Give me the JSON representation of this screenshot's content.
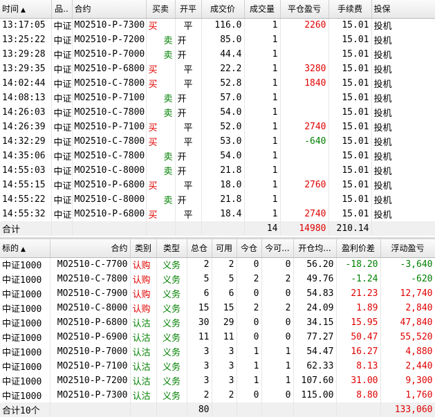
{
  "trades": {
    "headers": {
      "time": "时间",
      "sort_icon": "▲",
      "product": "品..",
      "contract": "合约",
      "direction": "买卖",
      "offset": "开平",
      "price": "成交价",
      "volume": "成交量",
      "close_pnl": "平仓盈亏",
      "fee": "手续费",
      "hedge": "投保"
    },
    "rows": [
      {
        "time": "13:17:05",
        "product": "中证",
        "contract": "MO2510-P-7300",
        "dir": "买",
        "dir_type": "buy",
        "offset": "平",
        "price": "116.0",
        "vol": "1",
        "pnl": "2260",
        "pnl_type": "pos",
        "fee": "15.01",
        "hedge": "投机"
      },
      {
        "time": "13:25:22",
        "product": "中证",
        "contract": "MO2510-P-7200",
        "dir": "卖",
        "dir_type": "sell",
        "offset": "开",
        "price": "85.0",
        "vol": "1",
        "pnl": "",
        "pnl_type": "",
        "fee": "15.01",
        "hedge": "投机"
      },
      {
        "time": "13:29:28",
        "product": "中证",
        "contract": "MO2510-P-7000",
        "dir": "卖",
        "dir_type": "sell",
        "offset": "开",
        "price": "44.4",
        "vol": "1",
        "pnl": "",
        "pnl_type": "",
        "fee": "15.01",
        "hedge": "投机"
      },
      {
        "time": "13:29:35",
        "product": "中证",
        "contract": "MO2510-P-6800",
        "dir": "买",
        "dir_type": "buy",
        "offset": "平",
        "price": "22.2",
        "vol": "1",
        "pnl": "3280",
        "pnl_type": "pos",
        "fee": "15.01",
        "hedge": "投机"
      },
      {
        "time": "14:02:44",
        "product": "中证",
        "contract": "MO2510-C-7800",
        "dir": "买",
        "dir_type": "buy",
        "offset": "平",
        "price": "52.8",
        "vol": "1",
        "pnl": "1840",
        "pnl_type": "pos",
        "fee": "15.01",
        "hedge": "投机"
      },
      {
        "time": "14:08:13",
        "product": "中证",
        "contract": "MO2510-P-7100",
        "dir": "卖",
        "dir_type": "sell",
        "offset": "开",
        "price": "57.0",
        "vol": "1",
        "pnl": "",
        "pnl_type": "",
        "fee": "15.01",
        "hedge": "投机"
      },
      {
        "time": "14:26:03",
        "product": "中证",
        "contract": "MO2510-C-7800",
        "dir": "卖",
        "dir_type": "sell",
        "offset": "开",
        "price": "54.0",
        "vol": "1",
        "pnl": "",
        "pnl_type": "",
        "fee": "15.01",
        "hedge": "投机"
      },
      {
        "time": "14:26:39",
        "product": "中证",
        "contract": "MO2510-P-7100",
        "dir": "买",
        "dir_type": "buy",
        "offset": "平",
        "price": "52.0",
        "vol": "1",
        "pnl": "2740",
        "pnl_type": "pos",
        "fee": "15.01",
        "hedge": "投机"
      },
      {
        "time": "14:32:29",
        "product": "中证",
        "contract": "MO2510-C-7800",
        "dir": "买",
        "dir_type": "buy",
        "offset": "平",
        "price": "53.0",
        "vol": "1",
        "pnl": "-640",
        "pnl_type": "neg",
        "fee": "15.01",
        "hedge": "投机"
      },
      {
        "time": "14:35:06",
        "product": "中证",
        "contract": "MO2510-C-7800",
        "dir": "卖",
        "dir_type": "sell",
        "offset": "开",
        "price": "54.0",
        "vol": "1",
        "pnl": "",
        "pnl_type": "",
        "fee": "15.01",
        "hedge": "投机"
      },
      {
        "time": "14:55:03",
        "product": "中证",
        "contract": "MO2510-C-8000",
        "dir": "卖",
        "dir_type": "sell",
        "offset": "开",
        "price": "21.8",
        "vol": "1",
        "pnl": "",
        "pnl_type": "",
        "fee": "15.01",
        "hedge": "投机"
      },
      {
        "time": "14:55:15",
        "product": "中证",
        "contract": "MO2510-P-6800",
        "dir": "买",
        "dir_type": "buy",
        "offset": "平",
        "price": "18.0",
        "vol": "1",
        "pnl": "2760",
        "pnl_type": "pos",
        "fee": "15.01",
        "hedge": "投机"
      },
      {
        "time": "14:55:22",
        "product": "中证",
        "contract": "MO2510-C-8000",
        "dir": "卖",
        "dir_type": "sell",
        "offset": "开",
        "price": "21.8",
        "vol": "1",
        "pnl": "",
        "pnl_type": "",
        "fee": "15.01",
        "hedge": "投机"
      },
      {
        "time": "14:55:32",
        "product": "中证",
        "contract": "MO2510-P-6800",
        "dir": "买",
        "dir_type": "buy",
        "offset": "平",
        "price": "18.4",
        "vol": "1",
        "pnl": "2740",
        "pnl_type": "pos",
        "fee": "15.01",
        "hedge": "投机"
      }
    ],
    "summary": {
      "label": "合计",
      "vol": "14",
      "pnl": "14980",
      "fee": "210.14"
    }
  },
  "positions": {
    "headers": {
      "underlying": "标的",
      "sort_icon": "▲",
      "contract": "合约",
      "category": "类别",
      "type": "类型",
      "total": "总仓",
      "available": "可用",
      "today": "今仓",
      "today_avail": "今可...",
      "open_avg": "开仓均...",
      "pnl_diff": "盈利价差",
      "float_pnl": "浮动盈亏"
    },
    "rows": [
      {
        "und": "中证1000",
        "contract": "MO2510-C-7700",
        "cat": "认购",
        "cat_type": "call",
        "type": "义务",
        "total": "2",
        "avail": "2",
        "today": "0",
        "today_avail": "0",
        "avg": "56.20",
        "diff": "-18.20",
        "diff_type": "neg",
        "float": "-3,640",
        "float_type": "neg"
      },
      {
        "und": "中证1000",
        "contract": "MO2510-C-7800",
        "cat": "认购",
        "cat_type": "call",
        "type": "义务",
        "total": "5",
        "avail": "5",
        "today": "2",
        "today_avail": "2",
        "avg": "49.76",
        "diff": "-1.24",
        "diff_type": "neg",
        "float": "-620",
        "float_type": "neg"
      },
      {
        "und": "中证1000",
        "contract": "MO2510-C-7900",
        "cat": "认购",
        "cat_type": "call",
        "type": "义务",
        "total": "6",
        "avail": "6",
        "today": "0",
        "today_avail": "0",
        "avg": "54.83",
        "diff": "21.23",
        "diff_type": "pos",
        "float": "12,740",
        "float_type": "pos"
      },
      {
        "und": "中证1000",
        "contract": "MO2510-C-8000",
        "cat": "认购",
        "cat_type": "call",
        "type": "义务",
        "total": "15",
        "avail": "15",
        "today": "2",
        "today_avail": "2",
        "avg": "24.09",
        "diff": "1.89",
        "diff_type": "pos",
        "float": "2,840",
        "float_type": "pos"
      },
      {
        "und": "中证1000",
        "contract": "MO2510-P-6800",
        "cat": "认沽",
        "cat_type": "put",
        "type": "义务",
        "total": "30",
        "avail": "29",
        "today": "0",
        "today_avail": "0",
        "avg": "34.15",
        "diff": "15.95",
        "diff_type": "pos",
        "float": "47,840",
        "float_type": "pos"
      },
      {
        "und": "中证1000",
        "contract": "MO2510-P-6900",
        "cat": "认沽",
        "cat_type": "put",
        "type": "义务",
        "total": "11",
        "avail": "11",
        "today": "0",
        "today_avail": "0",
        "avg": "77.27",
        "diff": "50.47",
        "diff_type": "pos",
        "float": "55,520",
        "float_type": "pos"
      },
      {
        "und": "中证1000",
        "contract": "MO2510-P-7000",
        "cat": "认沽",
        "cat_type": "put",
        "type": "义务",
        "total": "3",
        "avail": "3",
        "today": "1",
        "today_avail": "1",
        "avg": "54.47",
        "diff": "16.27",
        "diff_type": "pos",
        "float": "4,880",
        "float_type": "pos"
      },
      {
        "und": "中证1000",
        "contract": "MO2510-P-7100",
        "cat": "认沽",
        "cat_type": "put",
        "type": "义务",
        "total": "3",
        "avail": "3",
        "today": "1",
        "today_avail": "1",
        "avg": "62.33",
        "diff": "8.13",
        "diff_type": "pos",
        "float": "2,440",
        "float_type": "pos"
      },
      {
        "und": "中证1000",
        "contract": "MO2510-P-7200",
        "cat": "认沽",
        "cat_type": "put",
        "type": "义务",
        "total": "3",
        "avail": "3",
        "today": "1",
        "today_avail": "1",
        "avg": "107.60",
        "diff": "31.00",
        "diff_type": "pos",
        "float": "9,300",
        "float_type": "pos"
      },
      {
        "und": "中证1000",
        "contract": "MO2510-P-7300",
        "cat": "认沽",
        "cat_type": "put",
        "type": "义务",
        "total": "2",
        "avail": "2",
        "today": "0",
        "today_avail": "0",
        "avg": "115.00",
        "diff": "8.80",
        "diff_type": "pos",
        "float": "1,760",
        "float_type": "pos"
      }
    ],
    "summary": {
      "label": "合计10个",
      "total": "80",
      "float": "133,060"
    }
  },
  "colors": {
    "buy": "#e00000",
    "sell": "#008000",
    "profit": "#e00000",
    "loss": "#008000",
    "call": "#e00000",
    "put": "#008000"
  }
}
